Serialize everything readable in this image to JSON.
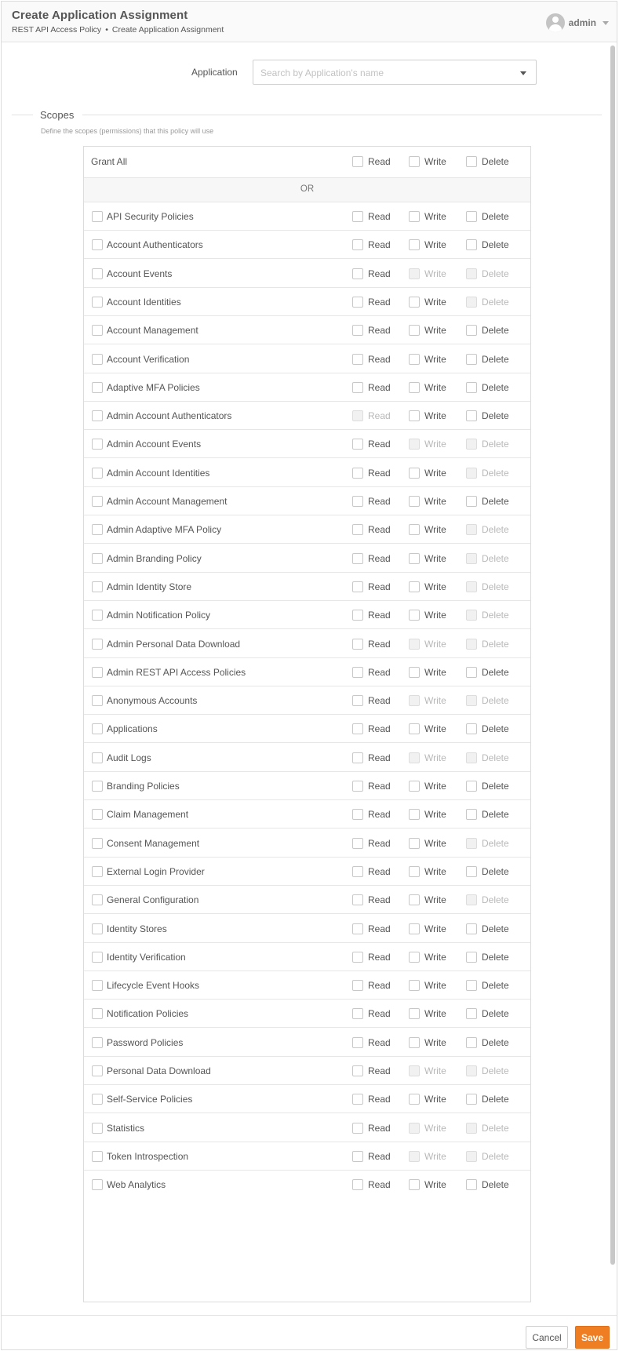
{
  "header": {
    "title": "Create Application Assignment",
    "breadcrumb": [
      "REST API Access Policy",
      "Create Application Assignment"
    ],
    "breadcrumb_separator": "•",
    "user_name": "admin"
  },
  "application": {
    "label": "Application",
    "placeholder": "Search by Application's name"
  },
  "scopes": {
    "title": "Scopes",
    "description": "Define the scopes (permissions) that this policy will use",
    "grant_all_label": "Grant All",
    "or_label": "OR",
    "perm_labels": {
      "read": "Read",
      "write": "Write",
      "delete": "Delete"
    },
    "items": [
      {
        "name": "API Security Policies",
        "read": true,
        "write": true,
        "delete": true
      },
      {
        "name": "Account Authenticators",
        "read": true,
        "write": true,
        "delete": true
      },
      {
        "name": "Account Events",
        "read": true,
        "write": false,
        "delete": false
      },
      {
        "name": "Account Identities",
        "read": true,
        "write": true,
        "delete": false
      },
      {
        "name": "Account Management",
        "read": true,
        "write": true,
        "delete": true
      },
      {
        "name": "Account Verification",
        "read": true,
        "write": true,
        "delete": true
      },
      {
        "name": "Adaptive MFA Policies",
        "read": true,
        "write": true,
        "delete": true
      },
      {
        "name": "Admin Account Authenticators",
        "read": false,
        "write": true,
        "delete": true
      },
      {
        "name": "Admin Account Events",
        "read": true,
        "write": false,
        "delete": false
      },
      {
        "name": "Admin Account Identities",
        "read": true,
        "write": true,
        "delete": false
      },
      {
        "name": "Admin Account Management",
        "read": true,
        "write": true,
        "delete": true
      },
      {
        "name": "Admin Adaptive MFA Policy",
        "read": true,
        "write": true,
        "delete": false
      },
      {
        "name": "Admin Branding Policy",
        "read": true,
        "write": true,
        "delete": false
      },
      {
        "name": "Admin Identity Store",
        "read": true,
        "write": true,
        "delete": false
      },
      {
        "name": "Admin Notification Policy",
        "read": true,
        "write": true,
        "delete": false
      },
      {
        "name": "Admin Personal Data Download",
        "read": true,
        "write": false,
        "delete": false
      },
      {
        "name": "Admin REST API Access Policies",
        "read": true,
        "write": true,
        "delete": true
      },
      {
        "name": "Anonymous Accounts",
        "read": true,
        "write": false,
        "delete": false
      },
      {
        "name": "Applications",
        "read": true,
        "write": true,
        "delete": true
      },
      {
        "name": "Audit Logs",
        "read": true,
        "write": false,
        "delete": false
      },
      {
        "name": "Branding Policies",
        "read": true,
        "write": true,
        "delete": true
      },
      {
        "name": "Claim Management",
        "read": true,
        "write": true,
        "delete": true
      },
      {
        "name": "Consent Management",
        "read": true,
        "write": true,
        "delete": false
      },
      {
        "name": "External Login Provider",
        "read": true,
        "write": true,
        "delete": true
      },
      {
        "name": "General Configuration",
        "read": true,
        "write": true,
        "delete": false
      },
      {
        "name": "Identity Stores",
        "read": true,
        "write": true,
        "delete": true
      },
      {
        "name": "Identity Verification",
        "read": true,
        "write": true,
        "delete": true
      },
      {
        "name": "Lifecycle Event Hooks",
        "read": true,
        "write": true,
        "delete": true
      },
      {
        "name": "Notification Policies",
        "read": true,
        "write": true,
        "delete": true
      },
      {
        "name": "Password Policies",
        "read": true,
        "write": true,
        "delete": true
      },
      {
        "name": "Personal Data Download",
        "read": true,
        "write": false,
        "delete": false
      },
      {
        "name": "Self-Service Policies",
        "read": true,
        "write": true,
        "delete": true
      },
      {
        "name": "Statistics",
        "read": true,
        "write": false,
        "delete": false
      },
      {
        "name": "Token Introspection",
        "read": true,
        "write": false,
        "delete": false
      },
      {
        "name": "Web Analytics",
        "read": true,
        "write": true,
        "delete": true
      }
    ]
  },
  "footer": {
    "cancel_label": "Cancel",
    "save_label": "Save"
  },
  "colors": {
    "accent": "#ef7d22",
    "border": "#dcdcdc",
    "text": "#555555",
    "disabled_text": "#b8b8b8"
  }
}
